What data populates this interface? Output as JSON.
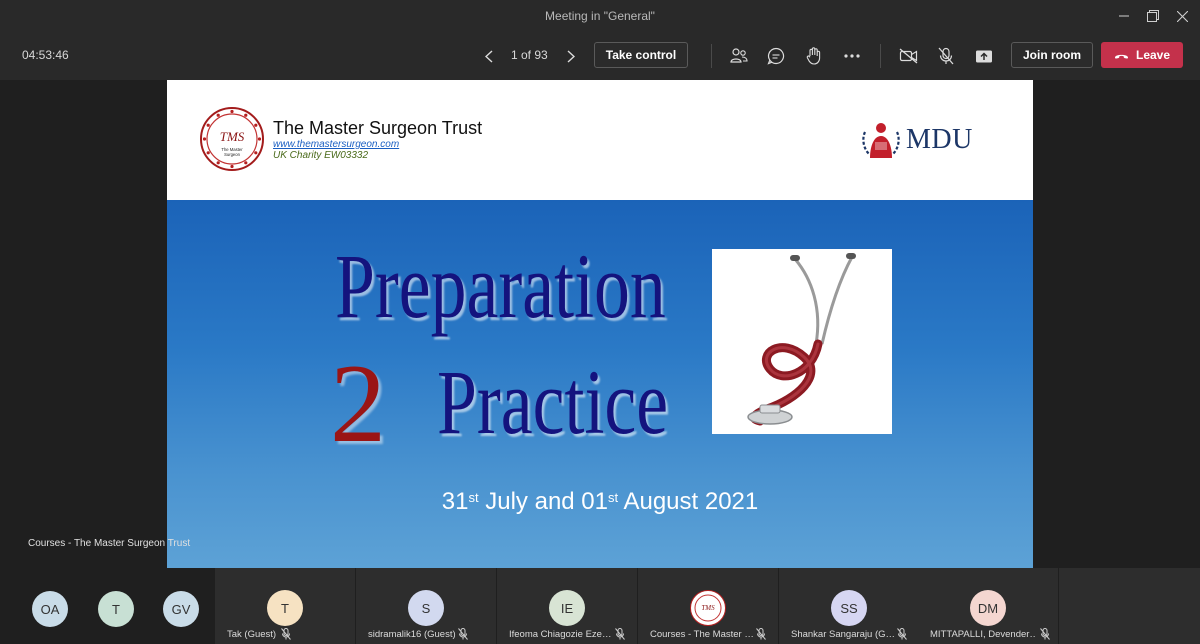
{
  "window": {
    "title": "Meeting in \"General\""
  },
  "toolbar": {
    "timer": "04:53:46",
    "page_indicator": "1 of 93",
    "take_control_label": "Take control",
    "join_room_label": "Join room",
    "leave_label": "Leave"
  },
  "slide": {
    "org_name": "The Master Surgeon Trust",
    "org_url": "www.themastersurgeon.com",
    "org_charity": "UK Charity EW03332",
    "logo_text_top": "TMS",
    "logo_text_bottom_1": "The Master",
    "logo_text_bottom_2": "Surgeon",
    "mdu_text": "MDU",
    "title_line1": "Preparation",
    "title_two": "2",
    "title_line2": "Practice",
    "date_d1": "31",
    "date_s1": "st",
    "date_mid": " July and 01",
    "date_s2": "st",
    "date_end": " August 2021"
  },
  "sharer_label": "Courses - The Master Surgeon Trust",
  "roster": {
    "small_avatars": [
      {
        "initials": "OA",
        "color": "#c9dce8"
      },
      {
        "initials": "T",
        "color": "#c8e0d4"
      },
      {
        "initials": "GV",
        "color": "#c9dce8"
      }
    ],
    "tiles": [
      {
        "initials": "T",
        "name": "Tak (Guest)",
        "color": "#f6e2c2"
      },
      {
        "initials": "S",
        "name": "sidramalik16 (Guest)",
        "color": "#d2d9ef"
      },
      {
        "initials": "IE",
        "name": "Ifeoma Chiagozie Eze…",
        "color": "#d8e4d4"
      },
      {
        "initials": "",
        "name": "Courses - The Master …",
        "color": "#ffffff"
      },
      {
        "initials": "SS",
        "name": "Shankar Sangaraju (G…",
        "color": "#d6d6f2"
      },
      {
        "initials": "DM",
        "name": "MITTAPALLI, Devender…",
        "color": "#f4d6d0"
      }
    ]
  },
  "colors": {
    "leave": "#c4314b",
    "slide_blue": "#1b63b8",
    "title_navy": "#14137e",
    "accent_red": "#9a1515"
  }
}
